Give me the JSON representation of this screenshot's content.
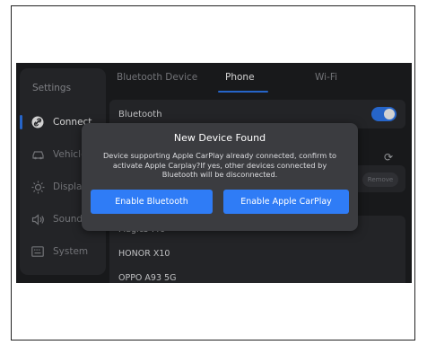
{
  "sidebar": {
    "title": "Settings",
    "items": [
      {
        "label": "Connect",
        "icon": "link-icon",
        "active": true
      },
      {
        "label": "Vehicle",
        "icon": "car-icon",
        "active": false
      },
      {
        "label": "Display",
        "icon": "sun-icon",
        "active": false
      },
      {
        "label": "Sound",
        "icon": "speaker-icon",
        "active": false
      },
      {
        "label": "System",
        "icon": "keyboard-icon",
        "active": false
      }
    ]
  },
  "tabs": [
    {
      "label": "Bluetooth Device",
      "active": false
    },
    {
      "label": "Phone",
      "active": true
    },
    {
      "label": "Wi-Fi",
      "active": false
    }
  ],
  "bluetooth_row": {
    "label": "Bluetooth",
    "toggle_on": true
  },
  "remove_label": "Remove",
  "devices": [
    "Magic5 Pro",
    "HONOR X10",
    "OPPO A93 5G"
  ],
  "dialog": {
    "title": "New Device Found",
    "message": "Device supporting Apple CarPlay already connected, confirm to activate Apple Carplay?If yes, other devices connected by Bluetooth will be disconnected.",
    "enable_bluetooth": "Enable Bluetooth",
    "enable_carplay": "Enable Apple CarPlay"
  },
  "colors": {
    "accent": "#2f7cf6",
    "background": "#1e1f22",
    "panel": "#2b2c30",
    "dialog": "#3b3c40"
  }
}
